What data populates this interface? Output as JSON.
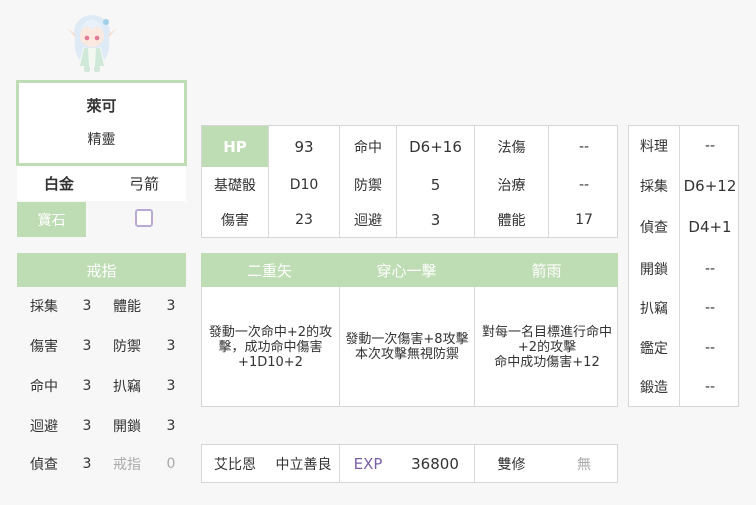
{
  "character": {
    "name": "萊可",
    "race": "精靈",
    "rank": "白金",
    "weapon": "弓箭",
    "gem_label": "寶石",
    "avatar_icon": "chibi-elf-avatar-icon"
  },
  "ring": {
    "header": "戒指",
    "stats": [
      {
        "label": "採集",
        "value": "3",
        "label2": "體能",
        "value2": "3"
      },
      {
        "label": "傷害",
        "value": "3",
        "label2": "防禦",
        "value2": "3"
      },
      {
        "label": "命中",
        "value": "3",
        "label2": "扒竊",
        "value2": "3"
      },
      {
        "label": "迴避",
        "value": "3",
        "label2": "開鎖",
        "value2": "3"
      },
      {
        "label": "偵查",
        "value": "3",
        "label2": "戒指",
        "value2": "0"
      }
    ]
  },
  "stats": {
    "rows": [
      [
        {
          "l": "HP",
          "v": "93"
        },
        {
          "l": "命中",
          "v": "D6+16"
        },
        {
          "l": "法傷",
          "v": "--"
        }
      ],
      [
        {
          "l": "基礎骰",
          "v": "D10"
        },
        {
          "l": "防禦",
          "v": "5"
        },
        {
          "l": "治療",
          "v": "--"
        }
      ],
      [
        {
          "l": "傷害",
          "v": "23"
        },
        {
          "l": "迴避",
          "v": "3"
        },
        {
          "l": "體能",
          "v": "17"
        }
      ]
    ]
  },
  "skills": [
    {
      "name": "二重矢",
      "desc": "發動一次命中+2的攻擊，成功命中傷害+1D10+2"
    },
    {
      "name": "穿心一擊",
      "desc": "發動一次傷害+8攻擊\n本次攻擊無視防禦"
    },
    {
      "name": "箭雨",
      "desc": "對每一名目標進行命中+2的攻擊\n命中成功傷害+12"
    }
  ],
  "bottom": {
    "deity": "艾比恩",
    "alignment": "中立善良",
    "exp_label": "EXP",
    "exp_value": "36800",
    "dual_label": "雙修",
    "dual_value": "無"
  },
  "side_skills": [
    {
      "label": "料理",
      "value": "--"
    },
    {
      "label": "採集",
      "value": "D6+12"
    },
    {
      "label": "偵查",
      "value": "D4+1"
    },
    {
      "label": "開鎖",
      "value": "--"
    },
    {
      "label": "扒竊",
      "value": "--"
    },
    {
      "label": "鑑定",
      "value": "--"
    },
    {
      "label": "鍛造",
      "value": "--"
    }
  ],
  "colors": {
    "accent_green": "#bfddb4",
    "exp_purple": "#7a5fa8",
    "checkbox_purple": "#b9a9d6"
  }
}
